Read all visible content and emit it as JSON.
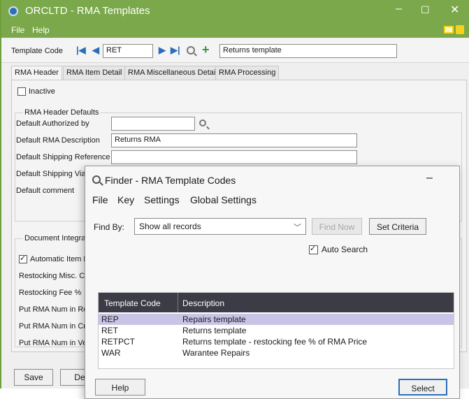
{
  "window": {
    "title": "ORCLTD - RMA Templates",
    "minimize": "–",
    "maximize": "☐",
    "close": "✕",
    "menu": [
      "File",
      "Help"
    ]
  },
  "toolbar": {
    "template_code_label": "Template Code",
    "template_code_value": "RET",
    "description_value": "Returns template"
  },
  "tabs": [
    "RMA Header",
    "RMA Item Detail",
    "RMA Miscellaneous Detail",
    "RMA Processing"
  ],
  "header_tab": {
    "inactive_label": "Inactive",
    "defaults_group": "RMA Header Defaults",
    "authorized_by_label": "Default Authorized by",
    "authorized_by_value": "",
    "rma_description_label": "Default RMA Description",
    "rma_description_value": "Returns RMA",
    "shipping_reference_label": "Default Shipping Reference",
    "shipping_reference_value": "",
    "shipping_via_label": "Default Shipping Via",
    "comment_label": "Default comment",
    "doc_integration_group": "Document Integratio",
    "auto_item_label": "Automatic Item R",
    "restocking_misc_label": "Restocking Misc. Ch",
    "restocking_fee_label": "Restocking Fee %",
    "put_rma_1": "Put RMA Num in Re",
    "put_rma_2": "Put RMA Num in Cre",
    "put_rma_3": "Put RMA Num in Ver"
  },
  "bottom_buttons": {
    "save": "Save",
    "delete": "De"
  },
  "finder": {
    "title": "Finder - RMA Template Codes",
    "minimize": "–",
    "menu": [
      "File",
      "Key",
      "Settings",
      "Global Settings"
    ],
    "find_by_label": "Find By:",
    "find_by_value": "Show all records",
    "find_now_label": "Find Now",
    "set_criteria_label": "Set Criteria",
    "auto_search_label": "Auto Search",
    "columns": [
      "Template Code",
      "Description"
    ],
    "rows": [
      {
        "code": "REP",
        "description": "Repairs template"
      },
      {
        "code": "RET",
        "description": "Returns template"
      },
      {
        "code": "RETPCT",
        "description": "Returns template - restocking fee % of RMA Price"
      },
      {
        "code": "WAR",
        "description": "Warantee Repairs"
      }
    ],
    "help_label": "Help",
    "select_label": "Select"
  },
  "colors": {
    "titlebar": "#7aa84a",
    "grid_header": "#3c3c46",
    "selected_row": "#c9c3e6",
    "nav_arrows": "#2a6ebb"
  }
}
